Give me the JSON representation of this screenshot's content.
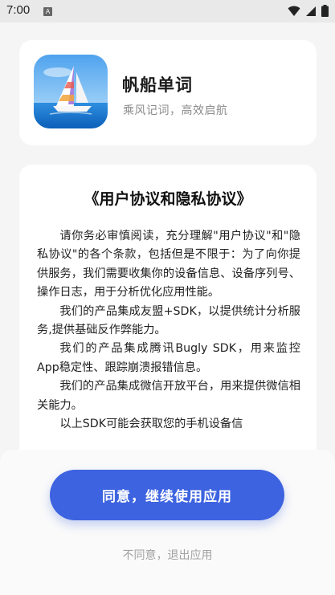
{
  "status_bar": {
    "time": "7:00",
    "notification_letter": "A"
  },
  "app": {
    "name": "帆船单词",
    "slogan": "乘风记词，高效启航"
  },
  "policy": {
    "title": "《用户协议和隐私协议》",
    "paragraphs": [
      "请你务必审慎阅读，充分理解\"用户协议\"和\"隐私协议\"的各个条款，包括但是不限于：为了向你提供服务，我们需要收集你的设备信息、设备序列号、操作日志，用于分析优化应用性能。",
      "我们的产品集成友盟+SDK，以提供统计分析服务,提供基础反作弊能力。",
      "我们的产品集成腾讯Bugly SDK，用来监控App稳定性、跟踪崩溃报错信息。",
      "我们的产品集成微信开放平台，用来提供微信相关能力。",
      "以上SDK可能会获取您的手机设备信"
    ]
  },
  "actions": {
    "agree_label": "同意，继续使用应用",
    "disagree_label": "不同意，退出应用"
  },
  "colors": {
    "primary": "#3d63e0",
    "background": "#f5f5f6"
  }
}
